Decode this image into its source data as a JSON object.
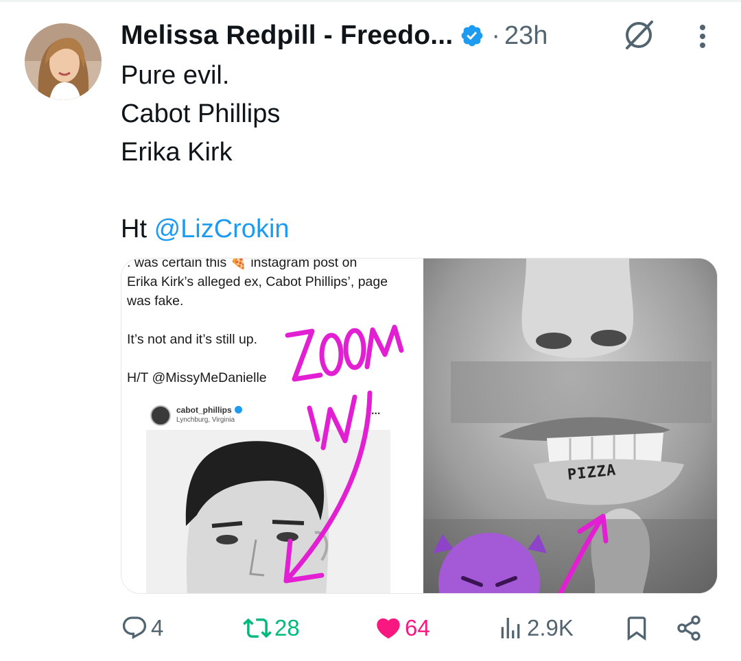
{
  "post": {
    "author_name": "Melissa Redpill - Freedo...",
    "separator": "·",
    "time": "23h",
    "text_lines": [
      "Pure evil.",
      "Cabot Phillips",
      "Erika Kirk"
    ],
    "ht_prefix": "Ht ",
    "mention": "@LizCrokin"
  },
  "media": {
    "left_panel": {
      "lines": [
        ". was certain this 🍕 instagram post on",
        "Erika Kirk’s alleged ex, Cabot Phillips’, page",
        "was fake.",
        "It’s not and it’s still up.",
        "H/T @MissyMeDanielle"
      ],
      "ig_username": "cabot_phillips",
      "ig_location": "Lynchburg, Virginia",
      "ig_more": "...",
      "annotation": "ZOOM IN"
    },
    "right_panel": {
      "tattoo_text": "PIZZA",
      "emoji": "smiling-devil"
    }
  },
  "actions": {
    "replies": "4",
    "reposts": "28",
    "likes": "64",
    "views": "2.9K"
  },
  "colors": {
    "accent": "#1d9bf0",
    "repost": "#00ba7c",
    "like": "#f91880",
    "muted": "#536471",
    "annotation": "#e21fd3"
  }
}
